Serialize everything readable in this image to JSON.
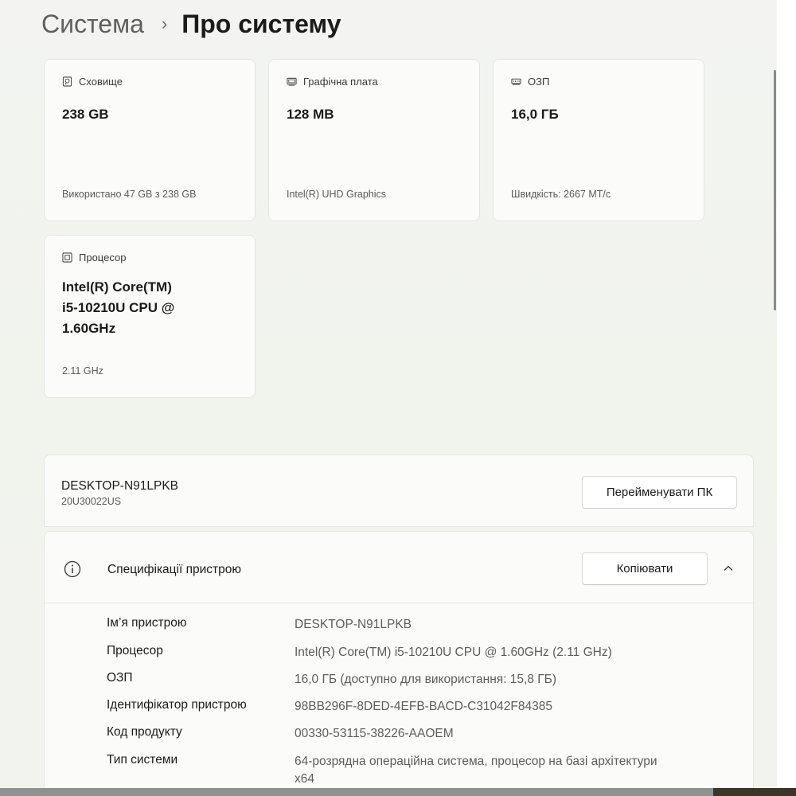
{
  "breadcrumb": {
    "parent": "Система",
    "separator": "›",
    "current": "Про систему"
  },
  "cards": {
    "storage": {
      "label": "Сховище",
      "value": "238 GB",
      "detail": "Використано 47 GB з 238 GB",
      "icon": "storage-icon"
    },
    "graphics": {
      "label": "Графічна плата",
      "value": "128 MB",
      "detail": "Intel(R) UHD Graphics",
      "icon": "graphics-card-icon"
    },
    "ram": {
      "label": "ОЗП",
      "value": "16,0 ГБ",
      "detail": "Швидкість: 2667 МТ/с",
      "icon": "ram-icon"
    },
    "cpu": {
      "label": "Процесор",
      "value_lines": [
        "Intel(R) Core(TM)",
        "i5-10210U CPU @",
        "1.60GHz"
      ],
      "detail": "2.11 GHz",
      "icon": "processor-icon"
    }
  },
  "device": {
    "name": "DESKTOP-N91LPKB",
    "model": "20U30022US",
    "rename_label": "Перейменувати ПК"
  },
  "specs": {
    "title": "Специфікації пристрою",
    "copy_label": "Копіювати",
    "rows": [
      {
        "label": "Ім’я пристрою",
        "value": "DESKTOP-N91LPKB"
      },
      {
        "label": "Процесор",
        "value": "Intel(R) Core(TM) i5-10210U CPU @ 1.60GHz (2.11 GHz)"
      },
      {
        "label": "ОЗП",
        "value": "16,0 ГБ (доступно для використання: 15,8 ГБ)"
      },
      {
        "label": "Ідентифікатор пристрою",
        "value": "98BB296F-8DED-4EFB-BACD-C31042F84385"
      },
      {
        "label": "Код продукту",
        "value": "00330-53115-38226-AAOEM"
      },
      {
        "label": "Тип системи",
        "value": "64-розрядна операційна система, процесор на базі архітектури x64"
      }
    ]
  }
}
